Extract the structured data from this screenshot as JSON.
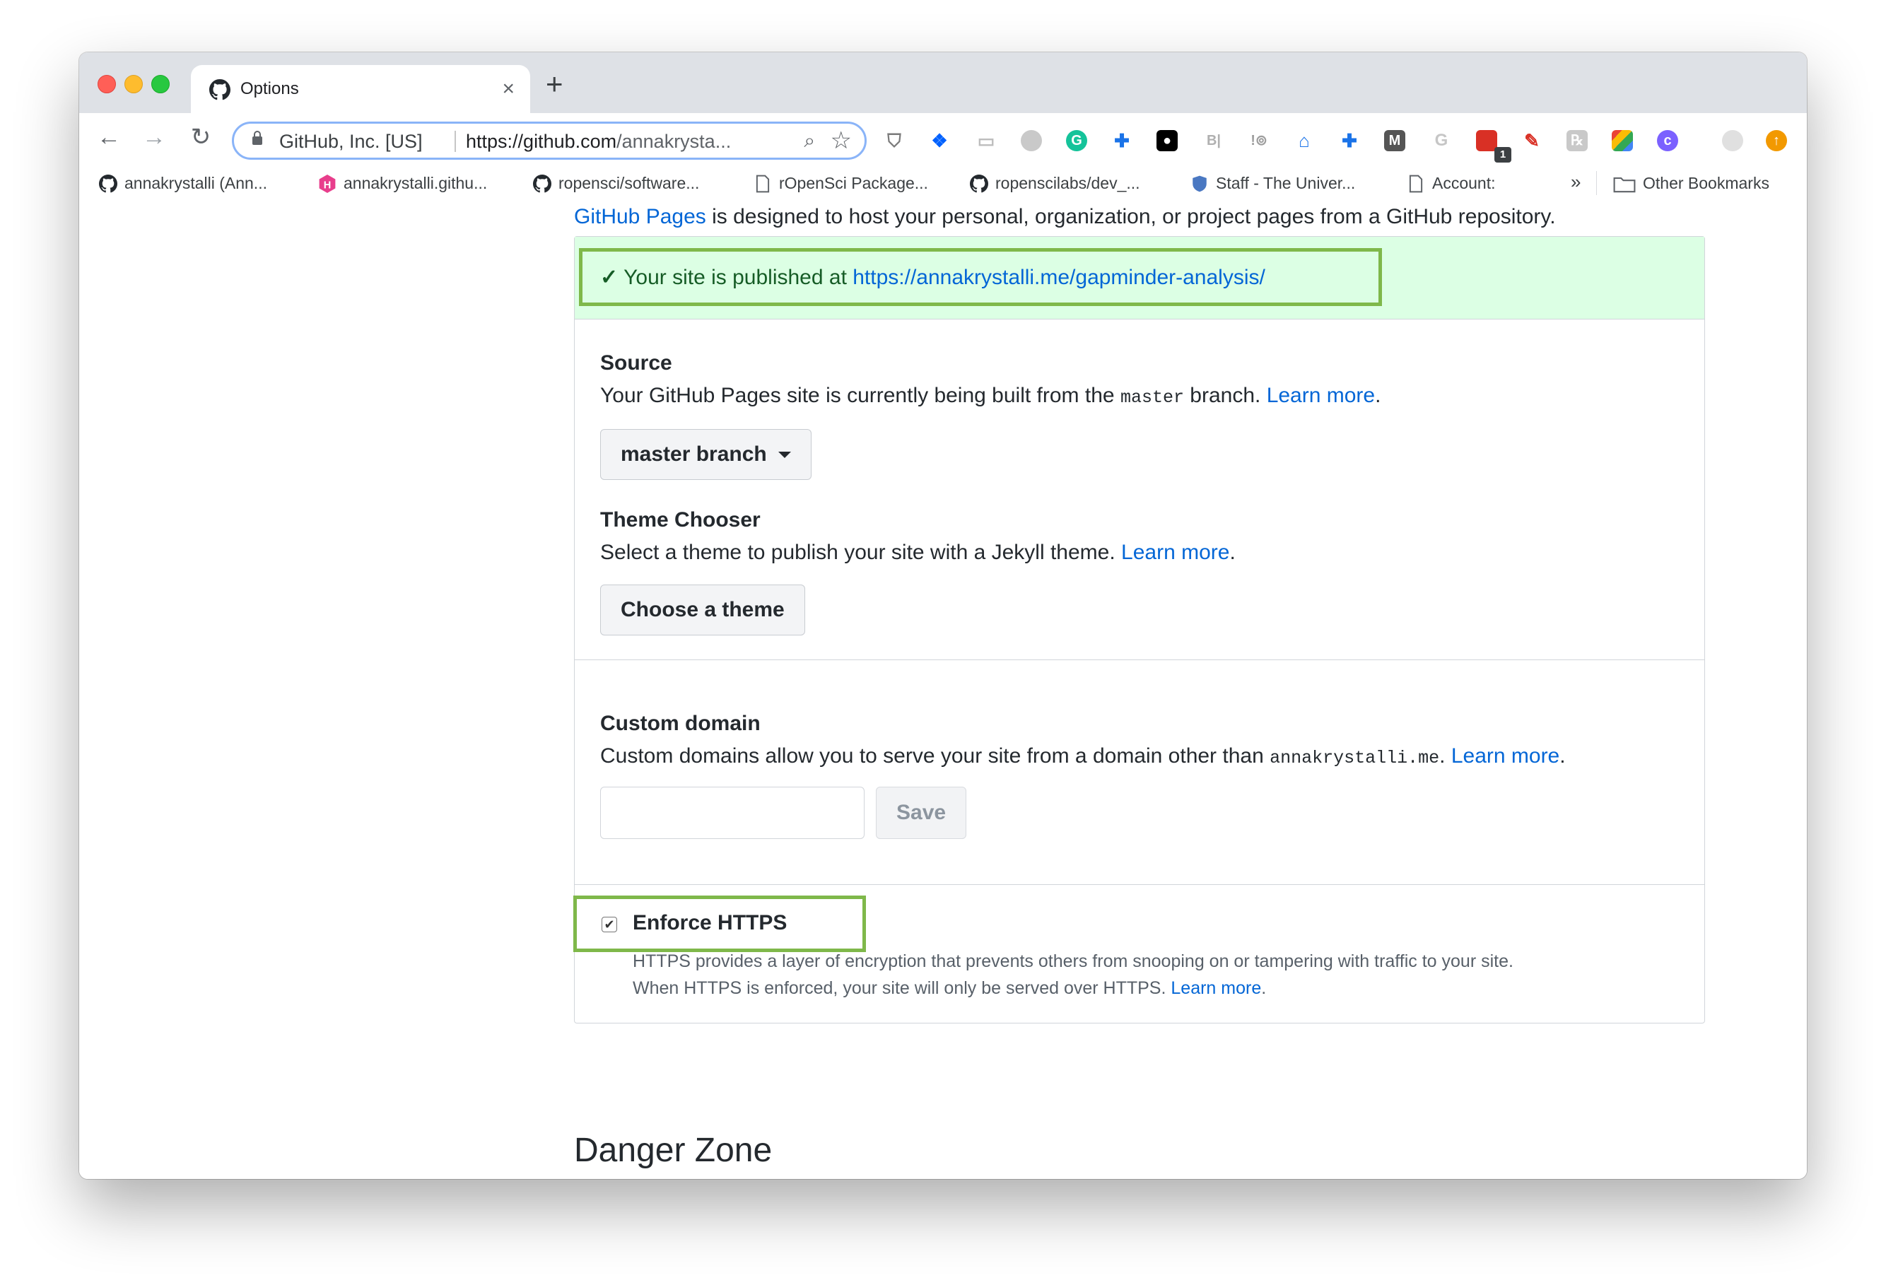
{
  "browser": {
    "tab_title": "Options",
    "new_tab_symbol": "+",
    "close_symbol": "×",
    "omnibox": {
      "org": "GitHub, Inc. [US]",
      "url_scheme": "https://",
      "url_host": "github.com",
      "url_path": "/annakrysta..."
    },
    "bookmarks": [
      {
        "label": "annakrystalli (Ann...",
        "icon": "github-icon"
      },
      {
        "label": "annakrystalli.githu...",
        "icon": "hexagon-icon"
      },
      {
        "label": "ropensci/software...",
        "icon": "github-icon"
      },
      {
        "label": "rOpenSci Package...",
        "icon": "page-icon"
      },
      {
        "label": "ropenscilabs/dev_...",
        "icon": "github-icon"
      },
      {
        "label": "Staff - The Univer...",
        "icon": "shield-icon"
      },
      {
        "label": "Account:",
        "icon": "page-icon"
      }
    ],
    "bookmarks_overflow": "»",
    "other_bookmarks": "Other Bookmarks",
    "extension_badge": "1"
  },
  "page": {
    "intro_link": "GitHub Pages",
    "intro_text": " is designed to host your personal, organization, or project pages from a GitHub repository.",
    "flash_prefix": "Your site is published at ",
    "flash_url": "https://annakrystalli.me/gapminder-analysis/",
    "source": {
      "title": "Source",
      "text_before": "Your GitHub Pages site is currently being built from the ",
      "branch_code": "master",
      "text_after": " branch. ",
      "learn_more": "Learn more",
      "period": ".",
      "button_label": "master branch"
    },
    "theme": {
      "title": "Theme Chooser",
      "text": "Select a theme to publish your site with a Jekyll theme. ",
      "learn_more": "Learn more",
      "period": ".",
      "button_label": "Choose a theme"
    },
    "custom_domain": {
      "title": "Custom domain",
      "text": "Custom domains allow you to serve your site from a domain other than ",
      "domain_code": "annakrystalli.me",
      "text_after": ". ",
      "learn_more": "Learn more",
      "period": ".",
      "input_value": "",
      "save_label": "Save"
    },
    "https": {
      "checked": true,
      "title": "Enforce HTTPS",
      "line1": "HTTPS provides a layer of encryption that prevents others from snooping on or tampering with traffic to your site.",
      "line2": "When HTTPS is enforced, your site will only be served over HTTPS. ",
      "learn_more": "Learn more",
      "period": "."
    },
    "danger_zone_title": "Danger Zone"
  },
  "colors": {
    "link": "#0366d6",
    "flash_bg": "#dcffe4",
    "highlight": "#7fb84a",
    "danger": "#cb2431"
  }
}
